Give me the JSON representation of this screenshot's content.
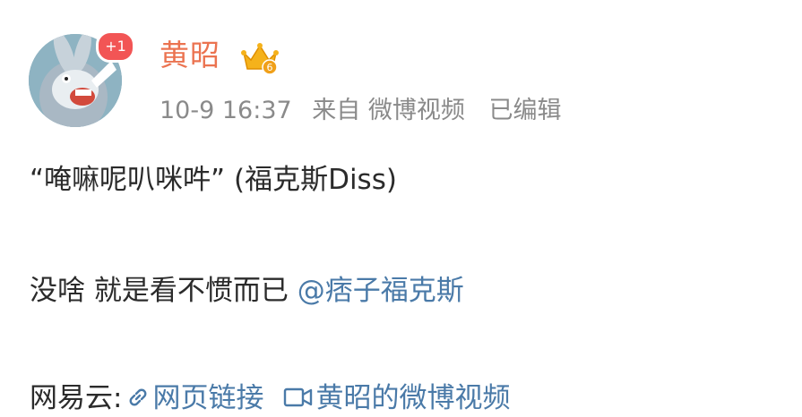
{
  "post": {
    "author": "黄昭",
    "notification_badge": "+1",
    "badge_icon": "crown-icon",
    "timestamp": "10-9 16:37",
    "source": "来自 微博视频",
    "edited": "已编辑",
    "line1": "“唵嘛呢叭咪吽” (福克斯Diss)",
    "line2_text": "没啥 就是看不惯而已 ",
    "mention": "@痞子福克斯",
    "line3_prefix": "网易云:",
    "web_link": "网页链接",
    "video_link": "黄昭的微博视频"
  },
  "colors": {
    "username": "#eb7350",
    "link": "#4a7aa8",
    "meta": "#8a8a8a",
    "badge": "#f25555"
  }
}
